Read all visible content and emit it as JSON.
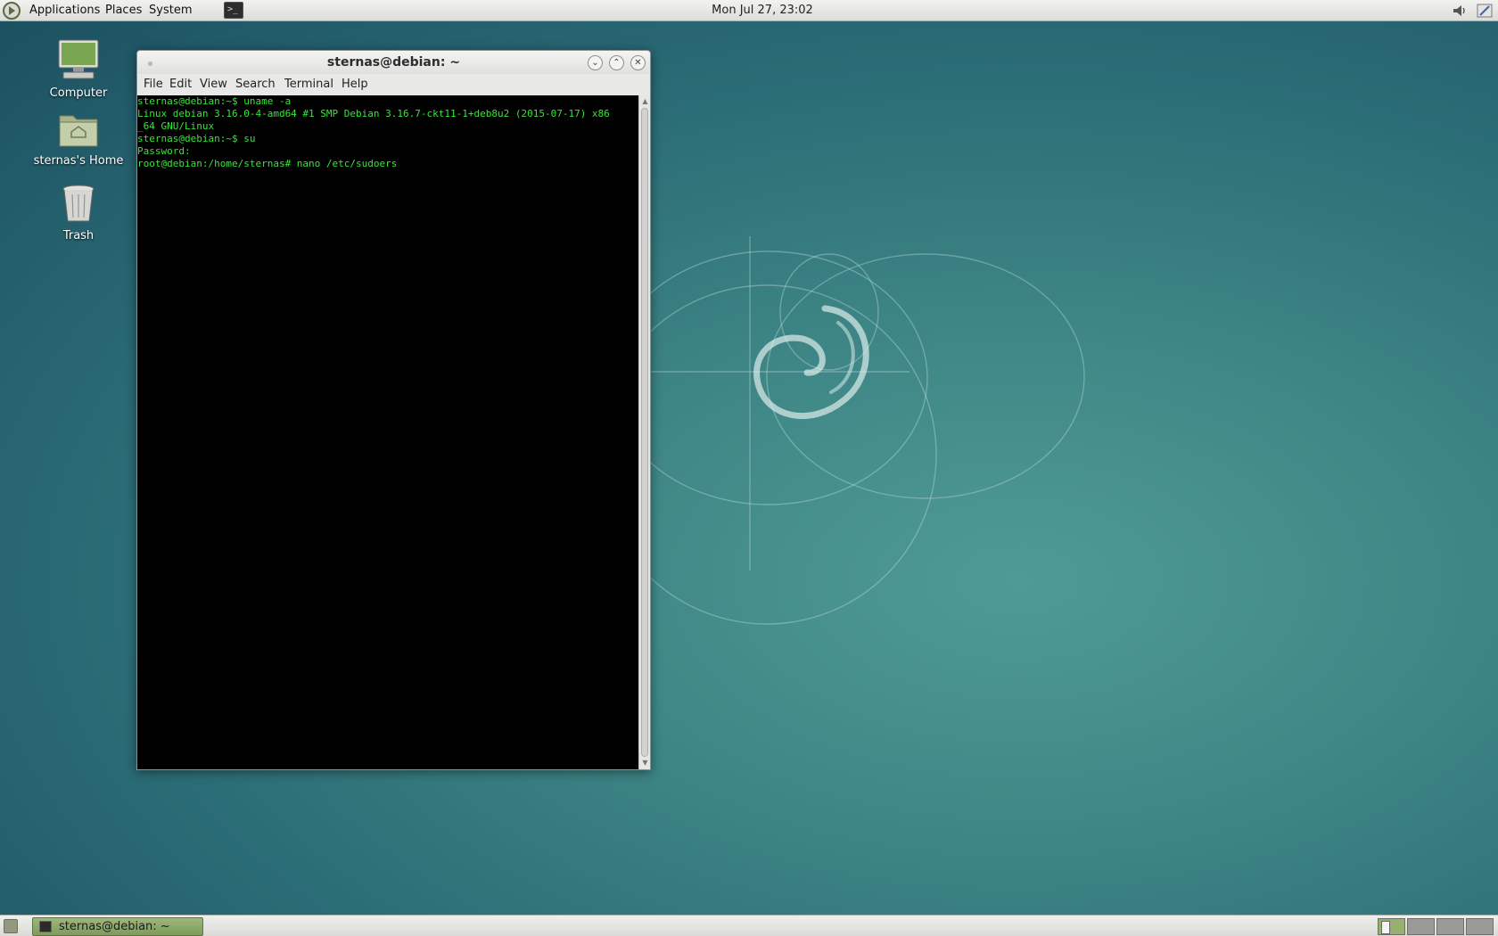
{
  "top_panel": {
    "menus": [
      "Applications",
      "Places",
      "System"
    ],
    "clock": "Mon Jul 27, 23:02",
    "launcher_icon": "terminal-icon",
    "tray_icons": [
      "volume-icon",
      "network-icon"
    ]
  },
  "desktop_icons": [
    {
      "label": "Computer",
      "icon": "computer-icon"
    },
    {
      "label": "sternas's Home",
      "icon": "home-folder-icon"
    },
    {
      "label": "Trash",
      "icon": "trash-icon"
    }
  ],
  "terminal": {
    "title": "sternas@debian: ~",
    "menu": [
      "File",
      "Edit",
      "View",
      "Search",
      "Terminal",
      "Help"
    ],
    "lines": [
      "sternas@debian:~$ uname -a",
      "Linux debian 3.16.0-4-amd64 #1 SMP Debian 3.16.7-ckt11-1+deb8u2 (2015-07-17) x86",
      "_64 GNU/Linux",
      "sternas@debian:~$ su",
      "Password:",
      "root@debian:/home/sternas# nano /etc/sudoers"
    ],
    "text_color": "#37e537",
    "background_color": "#000000"
  },
  "bottom_panel": {
    "task_label": "sternas@debian: ~",
    "workspaces": 4,
    "active_workspace": 1
  },
  "colors": {
    "desktop_teal": "#3f8786",
    "task_button_green": "#8ea96b"
  }
}
